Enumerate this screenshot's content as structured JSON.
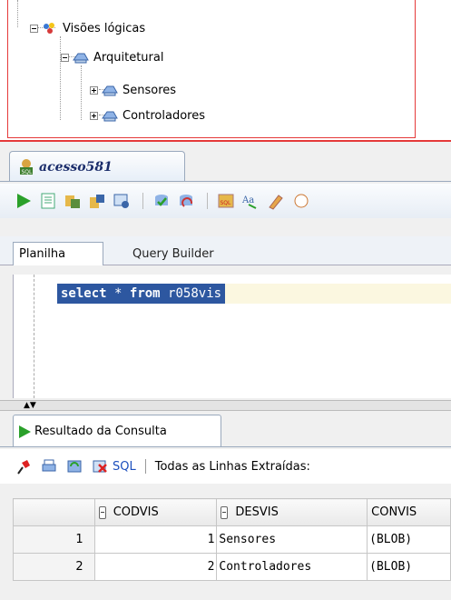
{
  "tree": {
    "root": "Visões lógicas",
    "child": "Arquitetural",
    "leaves": [
      "Sensores",
      "Controladores"
    ]
  },
  "connection_tab": {
    "label": "acesso581"
  },
  "subtabs": {
    "worksheet": "Planilha",
    "query_builder": "Query Builder"
  },
  "editor": {
    "keyword1": "select",
    "star": "*",
    "keyword2": "from",
    "table": "r058vis"
  },
  "results": {
    "tab_label": "Resultado da Consulta",
    "sql_link": "SQL",
    "status": "Todas as Linhas Extraídas:",
    "columns": [
      "CODVIS",
      "DESVIS",
      "CONVIS"
    ],
    "rows": [
      {
        "n": "1",
        "codvis": "1",
        "desvis": "Sensores",
        "convis": "(BLOB)"
      },
      {
        "n": "2",
        "codvis": "2",
        "desvis": "Controladores",
        "convis": "(BLOB)"
      }
    ]
  },
  "colors": {
    "highlight_border": "#e53a3a",
    "selection": "#2d57a0",
    "run_green": "#2aa02a"
  },
  "icons": [
    "run-statement-icon",
    "run-script-icon",
    "explain-plan-icon",
    "autotrace-icon",
    "sql-tuning-icon",
    "commit-icon",
    "rollback-icon",
    "sql-icon",
    "format-icon",
    "clear-icon",
    "pin-icon",
    "print-icon",
    "refresh-icon",
    "delete-icon"
  ]
}
